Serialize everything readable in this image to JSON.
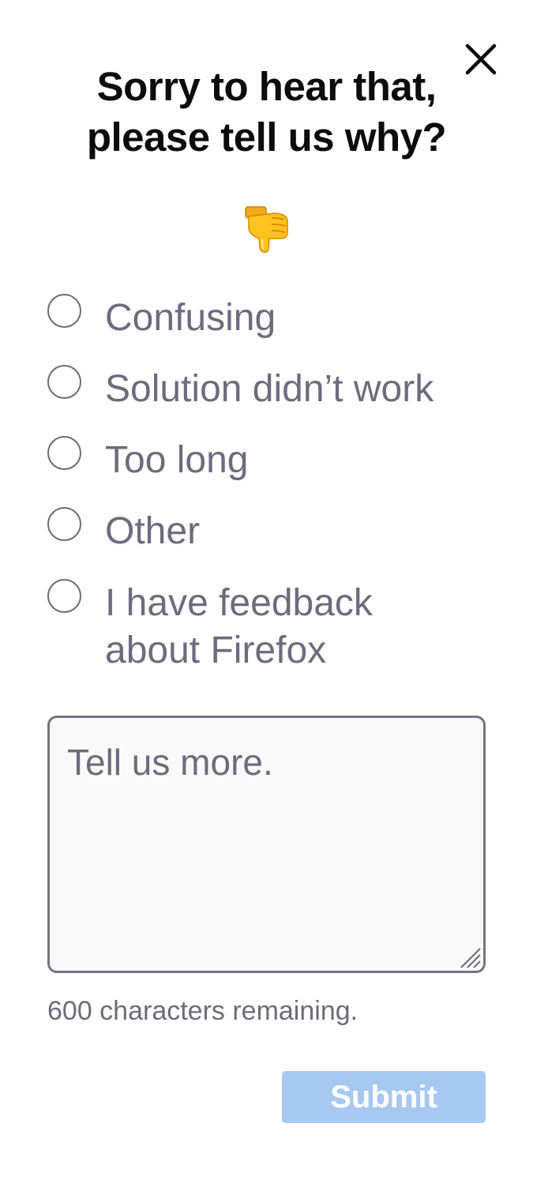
{
  "dialog": {
    "title_line1": "Sorry to hear that,",
    "title_line2": "please tell us why?",
    "close_icon": "close-icon",
    "reaction_icon": "thumbs-down-emoji"
  },
  "options": [
    {
      "label": "Confusing",
      "checked": false
    },
    {
      "label": "Solution didn’t work",
      "checked": false
    },
    {
      "label": "Too long",
      "checked": false
    },
    {
      "label": "Other",
      "checked": false
    },
    {
      "label_line1": "I have feedback",
      "label_line2": "about Firefox",
      "checked": false
    }
  ],
  "comment": {
    "placeholder": "Tell us more.",
    "value": ""
  },
  "char_remaining": "600 characters remaining.",
  "submit": {
    "label": "Submit",
    "enabled": false
  },
  "colors": {
    "title": "#0c0c0d",
    "muted_text": "#6d6b7c",
    "textarea_bg": "#f9f9fa",
    "textarea_border": "#76747f",
    "submit_bg_disabled": "#a6c8f1",
    "submit_text": "#ffffff"
  }
}
